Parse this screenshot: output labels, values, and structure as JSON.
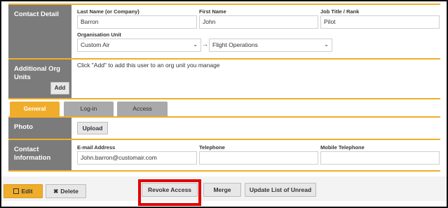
{
  "contact_detail": {
    "section_label": "Contact Detail",
    "last_name_label": "Last Name (or Company)",
    "last_name_value": "Barron",
    "first_name_label": "First Name",
    "first_name_value": "John",
    "job_title_label": "Job Title / Rank",
    "job_title_value": "Pilot",
    "org_unit_label": "Organisation Unit",
    "org_unit_value": "Custom Air",
    "arrow": "→",
    "sub_unit_value": "Flight Operations"
  },
  "additional_org_units": {
    "section_label": "Additional Org Units",
    "hint": "Click \"Add\" to add this user to an org unit you manage",
    "add_label": "Add"
  },
  "tabs": [
    {
      "label": "General",
      "active": true
    },
    {
      "label": "Log-in",
      "active": false
    },
    {
      "label": "Access",
      "active": false
    }
  ],
  "photo": {
    "section_label": "Photo",
    "upload_label": "Upload"
  },
  "contact_information": {
    "section_label": "Contact Information",
    "email_label": "E-mail Address",
    "email_value": "John.barron@customair.com",
    "telephone_label": "Telephone",
    "telephone_value": "",
    "mobile_label": "Mobile Telephone",
    "mobile_value": ""
  },
  "footer": {
    "edit_label": "Edit",
    "delete_label": "Delete",
    "revoke_label": "Revoke Access",
    "merge_label": "Merge",
    "update_label": "Update List of Unread"
  },
  "colors": {
    "accent": "#f0ad2b",
    "section_label_bg": "#7b7b7b",
    "highlight_box": "#e00000"
  },
  "icons": {
    "edit": "pencil-square-icon",
    "delete": "x-icon",
    "select": "chevron-down-icon"
  }
}
